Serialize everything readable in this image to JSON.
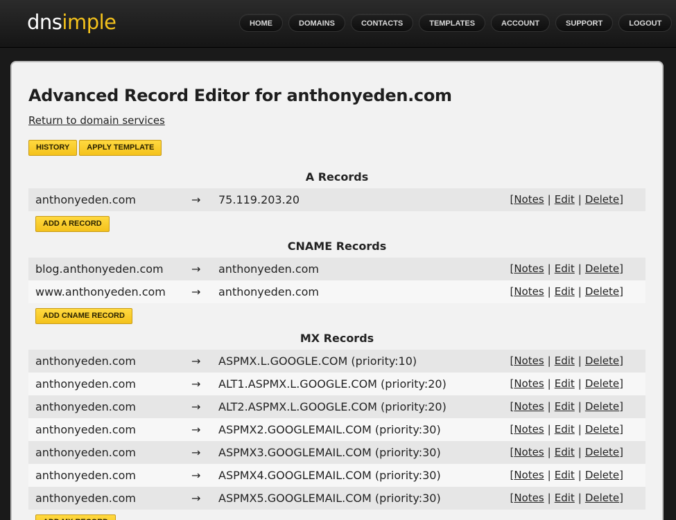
{
  "logo": {
    "part1": "dns",
    "part2": "imple"
  },
  "nav": [
    "HOME",
    "DOMAINS",
    "CONTACTS",
    "TEMPLATES",
    "ACCOUNT",
    "SUPPORT",
    "LOGOUT"
  ],
  "page": {
    "title": "Advanced Record Editor for anthonyeden.com",
    "return_link": "Return to domain services",
    "history_button": "HISTORY",
    "apply_template_button": "APPLY TEMPLATE"
  },
  "actions": {
    "open": "[",
    "notes": "Notes",
    "sep": "|",
    "edit": "Edit",
    "delete": "Delete",
    "close": "]"
  },
  "arrow": "→",
  "sections": {
    "a": {
      "title": "A Records",
      "add_label": "ADD A RECORD",
      "rows": [
        {
          "host": "anthonyeden.com",
          "target": "75.119.203.20"
        }
      ]
    },
    "cname": {
      "title": "CNAME Records",
      "add_label": "ADD CNAME RECORD",
      "rows": [
        {
          "host": "blog.anthonyeden.com",
          "target": "anthonyeden.com"
        },
        {
          "host": "www.anthonyeden.com",
          "target": "anthonyeden.com"
        }
      ]
    },
    "mx": {
      "title": "MX Records",
      "add_label": "ADD MX RECORD",
      "rows": [
        {
          "host": "anthonyeden.com",
          "target": "ASPMX.L.GOOGLE.COM (priority:10)"
        },
        {
          "host": "anthonyeden.com",
          "target": "ALT1.ASPMX.L.GOOGLE.COM (priority:20)"
        },
        {
          "host": "anthonyeden.com",
          "target": "ALT2.ASPMX.L.GOOGLE.COM (priority:20)"
        },
        {
          "host": "anthonyeden.com",
          "target": "ASPMX2.GOOGLEMAIL.COM (priority:30)"
        },
        {
          "host": "anthonyeden.com",
          "target": "ASPMX3.GOOGLEMAIL.COM (priority:30)"
        },
        {
          "host": "anthonyeden.com",
          "target": "ASPMX4.GOOGLEMAIL.COM (priority:30)"
        },
        {
          "host": "anthonyeden.com",
          "target": "ASPMX5.GOOGLEMAIL.COM (priority:30)"
        }
      ]
    }
  }
}
